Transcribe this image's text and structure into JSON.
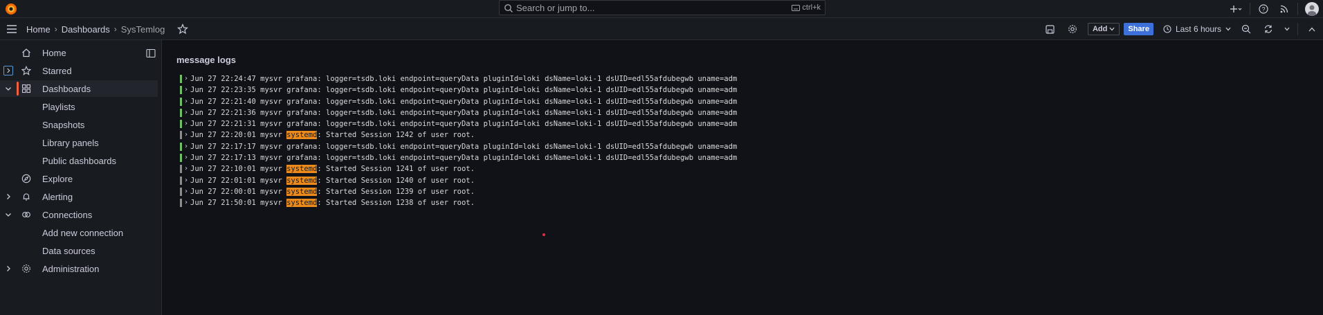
{
  "topbar": {
    "search_placeholder": "Search or jump to...",
    "search_shortcut": "ctrl+k"
  },
  "breadcrumb": [
    "Home",
    "Dashboards",
    "SysTemlog"
  ],
  "toolbar": {
    "add_label": "Add",
    "share_label": "Share",
    "time_range": "Last 6 hours"
  },
  "sidebar": {
    "items": [
      {
        "label": "Home"
      },
      {
        "label": "Starred"
      },
      {
        "label": "Dashboards"
      },
      {
        "label": "Playlists"
      },
      {
        "label": "Snapshots"
      },
      {
        "label": "Library panels"
      },
      {
        "label": "Public dashboards"
      },
      {
        "label": "Explore"
      },
      {
        "label": "Alerting"
      },
      {
        "label": "Connections"
      },
      {
        "label": "Add new connection"
      },
      {
        "label": "Data sources"
      },
      {
        "label": "Administration"
      }
    ]
  },
  "panel": {
    "title": "message logs"
  },
  "logs": [
    {
      "ts": "Jun 27 22:24:47",
      "host": "mysvr",
      "proc": "grafana",
      "msg": ": logger=tsdb.loki endpoint=queryData pluginId=loki dsName=loki-1 dsUID=edl55afdubegwb uname=admin fromAl",
      "level_color": "#73bf69",
      "highlight": false
    },
    {
      "ts": "Jun 27 22:23:35",
      "host": "mysvr",
      "proc": "grafana",
      "msg": ": logger=tsdb.loki endpoint=queryData pluginId=loki dsName=loki-1 dsUID=edl55afdubegwb uname=admin fromAl",
      "level_color": "#73bf69",
      "highlight": false
    },
    {
      "ts": "Jun 27 22:21:40",
      "host": "mysvr",
      "proc": "grafana",
      "msg": ": logger=tsdb.loki endpoint=queryData pluginId=loki dsName=loki-1 dsUID=edl55afdubegwb uname=admin fromAl",
      "level_color": "#73bf69",
      "highlight": false
    },
    {
      "ts": "Jun 27 22:21:36",
      "host": "mysvr",
      "proc": "grafana",
      "msg": ": logger=tsdb.loki endpoint=queryData pluginId=loki dsName=loki-1 dsUID=edl55afdubegwb uname=admin fromAl",
      "level_color": "#73bf69",
      "highlight": false
    },
    {
      "ts": "Jun 27 22:21:31",
      "host": "mysvr",
      "proc": "grafana",
      "msg": ": logger=tsdb.loki endpoint=queryData pluginId=loki dsName=loki-1 dsUID=edl55afdubegwb uname=admin fromAl",
      "level_color": "#73bf69",
      "highlight": false
    },
    {
      "ts": "Jun 27 22:20:01",
      "host": "mysvr",
      "proc": "systemd",
      "msg": ": Started Session 1242 of user root.",
      "level_color": "#8e8e8e",
      "highlight": true
    },
    {
      "ts": "Jun 27 22:17:17",
      "host": "mysvr",
      "proc": "grafana",
      "msg": ": logger=tsdb.loki endpoint=queryData pluginId=loki dsName=loki-1 dsUID=edl55afdubegwb uname=admin fromAl",
      "level_color": "#73bf69",
      "highlight": false
    },
    {
      "ts": "Jun 27 22:17:13",
      "host": "mysvr",
      "proc": "grafana",
      "msg": ": logger=tsdb.loki endpoint=queryData pluginId=loki dsName=loki-1 dsUID=edl55afdubegwb uname=admin fromAl",
      "level_color": "#73bf69",
      "highlight": false
    },
    {
      "ts": "Jun 27 22:10:01",
      "host": "mysvr",
      "proc": "systemd",
      "msg": ": Started Session 1241 of user root.",
      "level_color": "#8e8e8e",
      "highlight": true
    },
    {
      "ts": "Jun 27 22:01:01",
      "host": "mysvr",
      "proc": "systemd",
      "msg": ": Started Session 1240 of user root.",
      "level_color": "#8e8e8e",
      "highlight": true
    },
    {
      "ts": "Jun 27 22:00:01",
      "host": "mysvr",
      "proc": "systemd",
      "msg": ": Started Session 1239 of user root.",
      "level_color": "#8e8e8e",
      "highlight": true
    },
    {
      "ts": "Jun 27 21:50:01",
      "host": "mysvr",
      "proc": "systemd",
      "msg": ": Started Session 1238 of user root.",
      "level_color": "#8e8e8e",
      "highlight": true
    }
  ]
}
